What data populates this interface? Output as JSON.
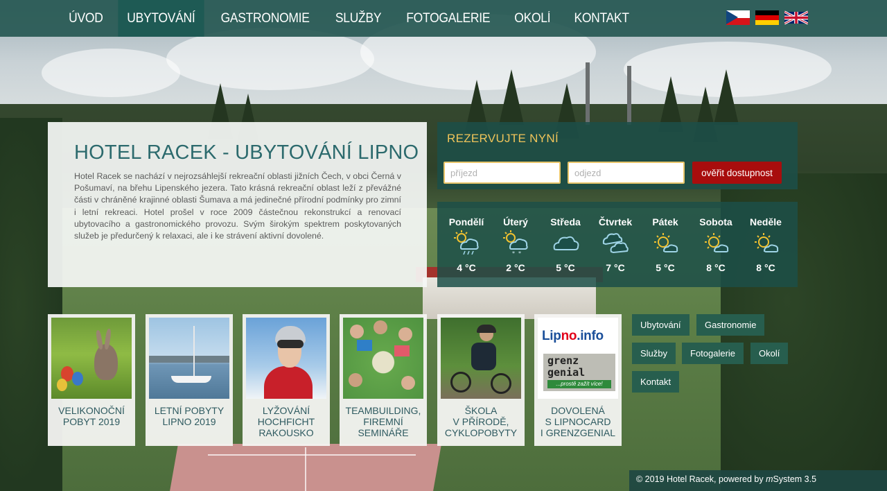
{
  "nav": {
    "items": [
      {
        "label": "ÚVOD",
        "active": false
      },
      {
        "label": "UBYTOVÁNÍ",
        "active": true
      },
      {
        "label": "GASTRONOMIE",
        "active": false
      },
      {
        "label": "SLUŽBY",
        "active": false
      },
      {
        "label": "FOTOGALERIE",
        "active": false
      },
      {
        "label": "OKOLÍ",
        "active": false
      },
      {
        "label": "KONTAKT",
        "active": false
      }
    ],
    "languages": [
      "cz-flag-icon",
      "de-flag-icon",
      "uk-flag-icon"
    ]
  },
  "intro": {
    "title": "HOTEL RACEK - UBYTOVÁNÍ LIPNO",
    "text": "Hotel Racek se nachází v nejrozsáhlejší rekreační oblasti jižních Čech, v obci Černá v Pošumaví, na břehu Lipenského jezera. Tato krásná rekreační oblast leží z převážné části v chráněné krajinné oblasti Šumava a má jedinečné přírodní podmínky pro zimní i letní rekreaci. Hotel prošel v roce 2009 částečnou rekonstrukcí a renovací ubytovacího a gastronomického provozu. Svým širokým spektrem poskytovaných služeb je předurčený k relaxaci, ale i ke strávení aktivní dovolené."
  },
  "reservation": {
    "title": "REZERVUJTE NYNÍ",
    "arrival_placeholder": "příjezd",
    "departure_placeholder": "odjezd",
    "button_label": "ověřit dostupnost"
  },
  "weather": {
    "days": [
      {
        "name": "Pondělí",
        "temp": "4 °C",
        "icon": "sun-cloud-rain-snow-icon"
      },
      {
        "name": "Úterý",
        "temp": "2 °C",
        "icon": "sun-cloud-snow-icon"
      },
      {
        "name": "Středa",
        "temp": "5 °C",
        "icon": "cloud-icon"
      },
      {
        "name": "Čtvrtek",
        "temp": "7 °C",
        "icon": "clouds-icon"
      },
      {
        "name": "Pátek",
        "temp": "5 °C",
        "icon": "sun-small-cloud-icon"
      },
      {
        "name": "Sobota",
        "temp": "8 °C",
        "icon": "sun-small-cloud-icon"
      },
      {
        "name": "Neděle",
        "temp": "8 °C",
        "icon": "sun-small-cloud-icon"
      }
    ]
  },
  "cards": [
    {
      "label": "VELIKONOČNÍ\nPOBYT 2019",
      "image": "easter-bunny-image"
    },
    {
      "label": "LETNÍ POBYTY\nLIPNO 2019",
      "image": "sailboat-lake-image"
    },
    {
      "label": "LYŽOVÁNÍ\nHOCHFICHT\nRAKOUSKO",
      "image": "skier-image"
    },
    {
      "label": "TEAMBUILDING,\nFIREMNÍ\nSEMINÁŘE",
      "image": "teambuilding-group-image"
    },
    {
      "label": "ŠKOLA\nV PŘÍRODĚ,\nCYKLOPOBYTY",
      "image": "cyclist-image"
    },
    {
      "label": "DOVOLENÁ\nS LIPNOCARD\nI GRENZGENIAL",
      "image": "lipno-info-grenzgenial-logo"
    }
  ],
  "logo_text": {
    "lipno_a": "Lip",
    "lipno_b": "no",
    "lipno_c": ".info",
    "grenz_1": "grenz",
    "grenz_2": "genial",
    "grenz_tag": "...prostě zažít více!"
  },
  "quick_links": [
    "Ubytování",
    "Gastronomie",
    "Služby",
    "Fotogalerie",
    "Okolí",
    "Kontakt"
  ],
  "footer": {
    "prefix": "© 2019 Hotel Racek, powered by ",
    "brand_m": "m",
    "brand_rest": "System 3.5"
  },
  "colors": {
    "nav_bg": "#265852",
    "accent_gold": "#f0c45a",
    "button_red": "#a80d0d",
    "title_teal": "#2c6a6d"
  }
}
